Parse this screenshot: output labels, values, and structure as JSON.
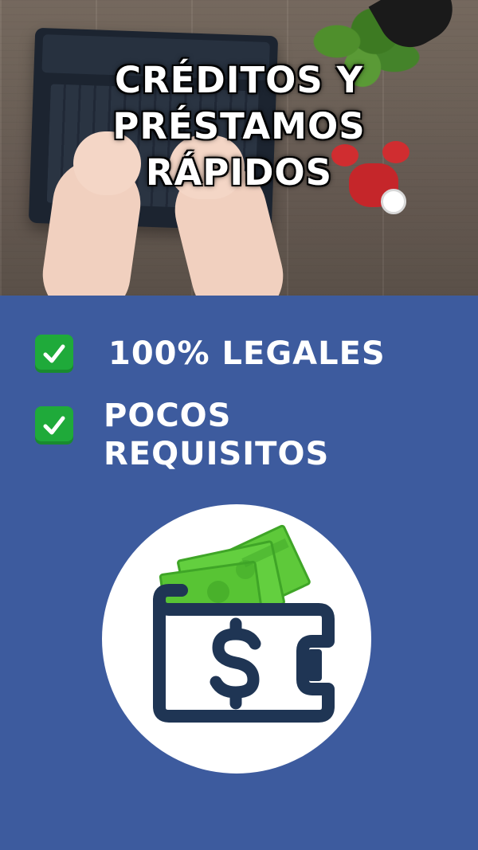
{
  "hero": {
    "title_lines": [
      "CRÉDITOS  Y",
      "PRÉSTAMOS",
      "RÁPIDOS"
    ]
  },
  "features": [
    {
      "label": "100% LEGALES",
      "icon": "check-mark-button-icon"
    },
    {
      "label_lines": [
        "POCOS",
        "REQUISITOS"
      ],
      "icon": "check-mark-button-icon"
    }
  ],
  "illustration": {
    "icon": "wallet-with-cash-dollar-icon"
  },
  "colors": {
    "background_blue": "#3d5b9e",
    "check_green": "#1faa3a",
    "cash_green": "#5ec93a",
    "wallet_navy": "#1f3554"
  }
}
